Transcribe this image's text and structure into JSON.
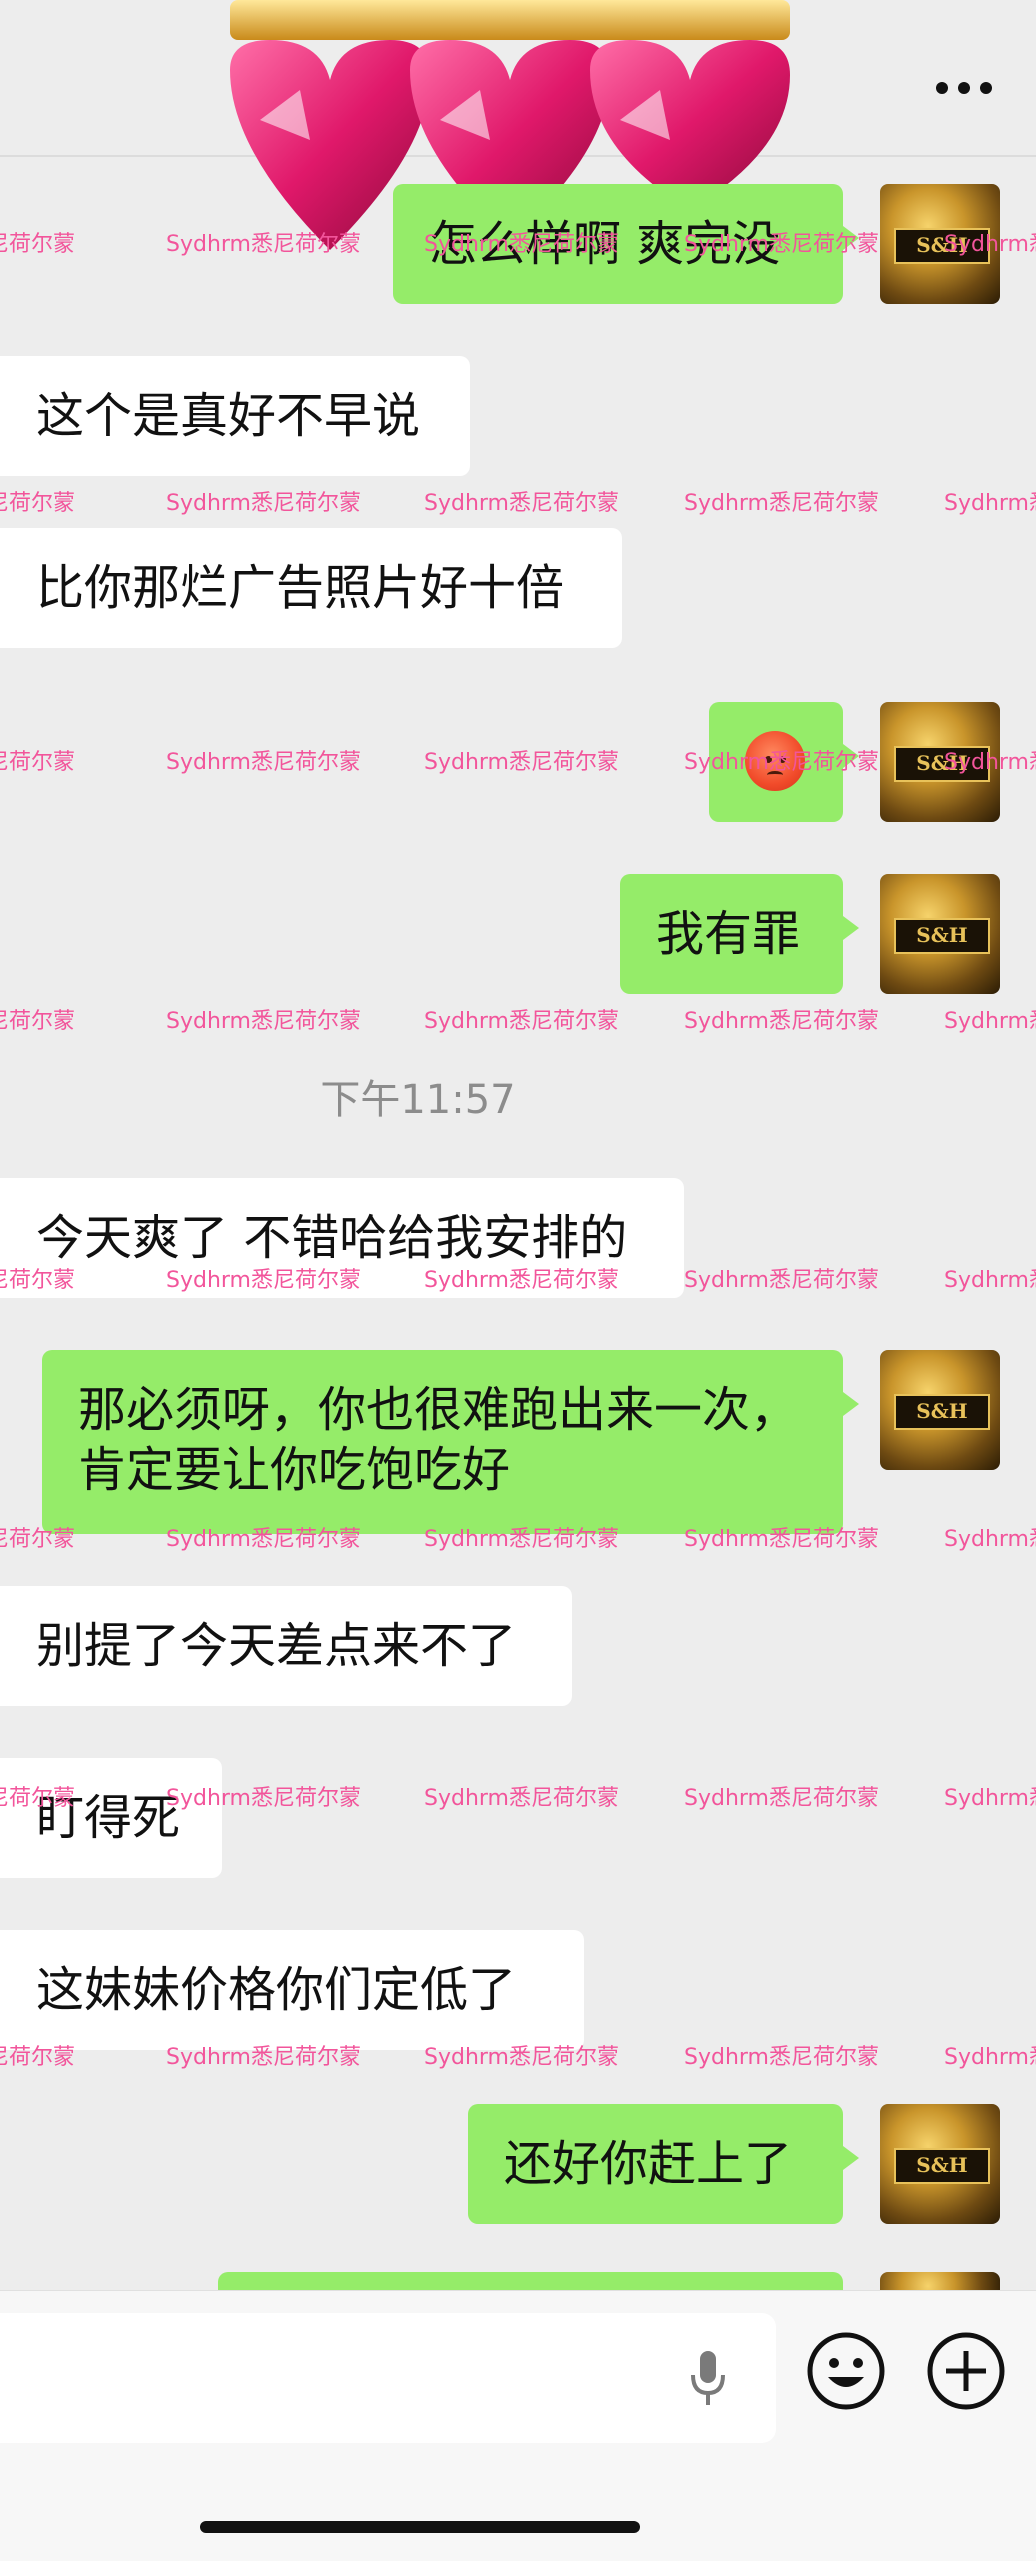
{
  "header": {
    "more_icon": "more-icon"
  },
  "timestamp": "下午11:57",
  "watermark": "Sydhrm悉尼荷尔蒙",
  "avatar_text": "S&H",
  "messages": [
    {
      "side": "out",
      "text": "怎么样啊  爽完没"
    },
    {
      "side": "in",
      "text": "这个是真好不早说"
    },
    {
      "side": "in",
      "text": "比你那烂广告照片好十倍"
    },
    {
      "side": "out",
      "text": "",
      "emoji": "red-face-emoji"
    },
    {
      "side": "out",
      "text": "我有罪"
    },
    {
      "side": "in",
      "text": "今天爽了 不错哈给我安排的"
    },
    {
      "side": "out",
      "text": "那必须呀，你也很难跑出来一次，",
      "text2": "肯定要让你吃饱吃好"
    },
    {
      "side": "in",
      "text": "别提了今天差点来不了"
    },
    {
      "side": "in",
      "text": "盯得死"
    },
    {
      "side": "in",
      "text": "这妹妹价格你们定低了"
    },
    {
      "side": "out",
      "text": "还好你赶上了"
    }
  ],
  "input": {
    "mic_icon": "microphone-icon",
    "emoji_icon": "emoji-icon",
    "plus_icon": "plus-icon"
  },
  "colors": {
    "background": "#ededed",
    "outgoing": "#95ec69",
    "incoming": "#ffffff",
    "watermark": "#f2559b"
  }
}
